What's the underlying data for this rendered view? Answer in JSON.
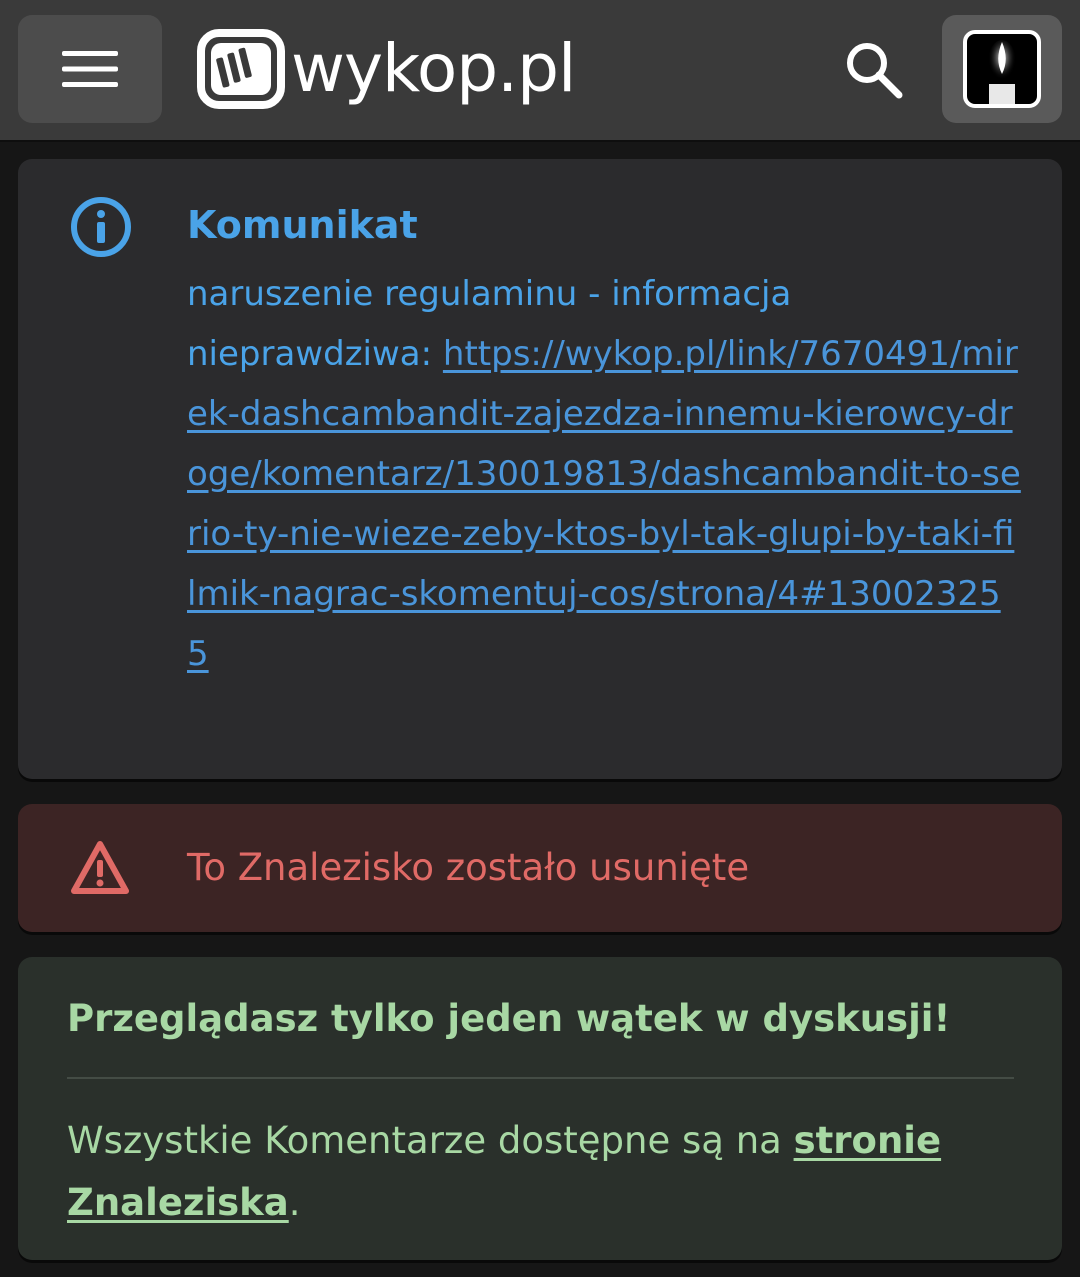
{
  "header": {
    "logo_text": "wykop.pl",
    "menu_icon": "hamburger-menu-icon",
    "search_icon": "search-icon",
    "avatar_icon": "candle-avatar"
  },
  "notice": {
    "icon": "info-icon",
    "title": "Komunikat",
    "message": "naruszenie regulaminu - informacja nieprawdziwa:",
    "link": "https://wykop.pl/link/7670491/mirek-dashcambandit-zajezdza-innemu-kierowcy-droge/komentarz/130019813/dashcambandit-to-serio-ty-nie-wieze-zeby-ktos-byl-tak-glupi-by-taki-filmik-nagrac-skomentuj-cos/strona/4#130023255",
    "color": "#4aa3e8"
  },
  "removed_banner": {
    "icon": "warning-icon",
    "text": "To Znalezisko zostało usunięte",
    "color": "#e06a66"
  },
  "thread_notice": {
    "title": "Przeglądasz tylko jeden wątek w dyskusji!",
    "text_before": "Wszystkie Komentarze dostępne są na ",
    "link_text": "stronie Znaleziska",
    "text_after": ".",
    "color": "#a8d8a4"
  }
}
